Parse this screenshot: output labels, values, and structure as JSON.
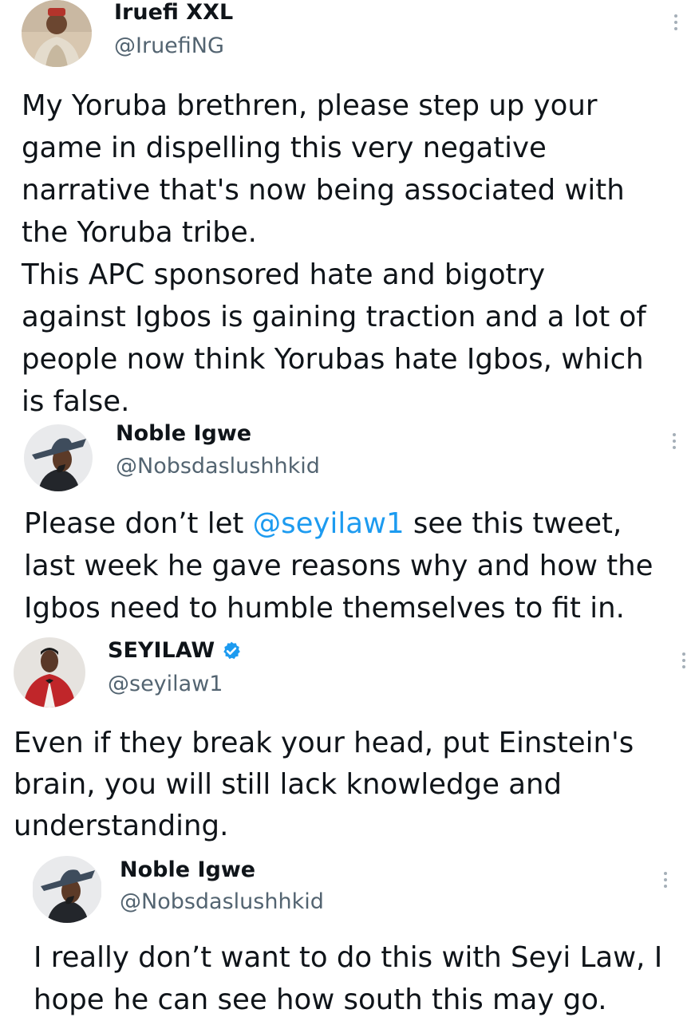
{
  "tweets": [
    {
      "display_name": "Iruefi XXL",
      "handle": "@IruefiNG",
      "verified": false,
      "text": "My Yoruba brethren, please step up your\ngame in dispelling this very negative\nnarrative that's now being associated with\nthe Yoruba tribe.\nThis APC sponsored hate and bigotry\nagainst Igbos is gaining traction and a lot of\npeople now think Yorubas hate Igbos, which\nis false."
    },
    {
      "display_name": "Noble Igwe",
      "handle": "@Nobsdaslushhkid",
      "verified": false,
      "text_before_mention": "Please don’t let ",
      "mention": "@seyilaw1",
      "text_after_mention": " see this tweet,\nlast week he gave reasons why and how the\nIgbos need to humble themselves to fit in."
    },
    {
      "display_name": "SEYILAW",
      "handle": "@seyilaw1",
      "verified": true,
      "text": "Even if they break your head, put Einstein's\nbrain, you will still lack knowledge and\nunderstanding."
    },
    {
      "display_name": "Noble Igwe",
      "handle": "@Nobsdaslushhkid",
      "verified": false,
      "text": "I really don’t want to do this with Seyi Law, I\nhope he can see how south this may go."
    }
  ],
  "icons": {
    "more": "more-vertical-icon",
    "verified": "verified-badge-icon"
  },
  "colors": {
    "text": "#0f1419",
    "handle": "#536471",
    "mention": "#1d9bf0",
    "verified": "#1d9bf0"
  }
}
